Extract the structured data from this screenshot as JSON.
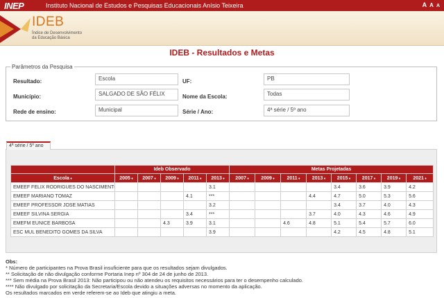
{
  "header": {
    "logo": "INEP",
    "institution": "Instituto Nacional de Estudos e Pesquisas Educacionais Anísio Teixeira",
    "font_controls": [
      "A",
      "A",
      "A"
    ]
  },
  "banner": {
    "title": "IDEB",
    "subtitle_line1": "Índice de Desenvolvimento",
    "subtitle_line2": "da Educação Básica"
  },
  "page_title": "IDEB - Resultados e Metas",
  "params": {
    "legend": "Parâmetros da Pesquisa",
    "resultado_label": "Resultado:",
    "resultado_value": "Escola",
    "uf_label": "UF:",
    "uf_value": "PB",
    "municipio_label": "Município:",
    "municipio_value": "SALGADO DE SÃO FÉLIX",
    "escola_label": "Nome da Escola:",
    "escola_value": "Todas",
    "rede_label": "Rede de ensino:",
    "rede_value": "Municipal",
    "serie_label": "Série / Ano:",
    "serie_value": "4ª série / 5º ano"
  },
  "tab_label": "4ª série / 5º ano",
  "table": {
    "group_observed": "Ideb Observado",
    "group_projected": "Metas Projetadas",
    "escola_header": "Escola",
    "observed_years": [
      "2005",
      "2007",
      "2009",
      "2011",
      "2013"
    ],
    "projected_years": [
      "2007",
      "2009",
      "2011",
      "2013",
      "2015",
      "2017",
      "2019",
      "2021"
    ],
    "rows": [
      {
        "escola": "EMEEF FELIX RODRIGUES DO NASCIMENTO",
        "obs": [
          "",
          "",
          "",
          "",
          "3.1"
        ],
        "proj": [
          "",
          "",
          "",
          "",
          "3.4",
          "3.6",
          "3.9",
          "4.2"
        ]
      },
      {
        "escola": "EMEEF MARIANO TOMAZ",
        "obs": [
          "",
          "",
          "",
          "4.1",
          "***"
        ],
        "proj": [
          "",
          "",
          "",
          "4.4",
          "4.7",
          "5.0",
          "5.3",
          "5.6"
        ]
      },
      {
        "escola": "EMEEF PROFESSOR JOSE MATIAS",
        "obs": [
          "",
          "",
          "",
          "",
          "3.2"
        ],
        "proj": [
          "",
          "",
          "",
          "",
          "3.4",
          "3.7",
          "4.0",
          "4.3"
        ]
      },
      {
        "escola": "EMEEF SILVINA SERGIA",
        "obs": [
          "",
          "",
          "",
          "3.4",
          "***"
        ],
        "proj": [
          "",
          "",
          "",
          "3.7",
          "4.0",
          "4.3",
          "4.6",
          "4.9"
        ]
      },
      {
        "escola": "EMEFM EUNICE BARBOSA",
        "obs": [
          "",
          "",
          "4.3",
          "3.9",
          "3.1"
        ],
        "proj": [
          "",
          "",
          "4.6",
          "4.8",
          "5.1",
          "5.4",
          "5.7",
          "6.0"
        ]
      },
      {
        "escola": "ESC MUL BENEDITO GOMES DA SILVA",
        "obs": [
          "",
          "",
          "",
          "",
          "3.9"
        ],
        "proj": [
          "",
          "",
          "",
          "",
          "4.2",
          "4.5",
          "4.8",
          "5.1"
        ]
      }
    ]
  },
  "obs": {
    "title": "Obs:",
    "lines": [
      "* Número de participantes na Prova Brasil insuficiente para que os resultados sejam divulgados.",
      "** Solicitação de não divulgação conforme Portaria Inep nº 304 de 24 de junho de 2013.",
      "*** Sem média na Prova Brasil 2013: Não participou ou não atendeu os requisitos necessários para ter o desempenho calculado.",
      "**** Não divulgado por solicitação da Secretaria/Escola devido a situações adversas no momento da aplicação.",
      "Os resultados marcados em verde referem-se ao Ideb que atingiu a meta."
    ]
  },
  "colors": {
    "brand_red": "#b01c1c",
    "ideb_orange": "#d8741a"
  }
}
